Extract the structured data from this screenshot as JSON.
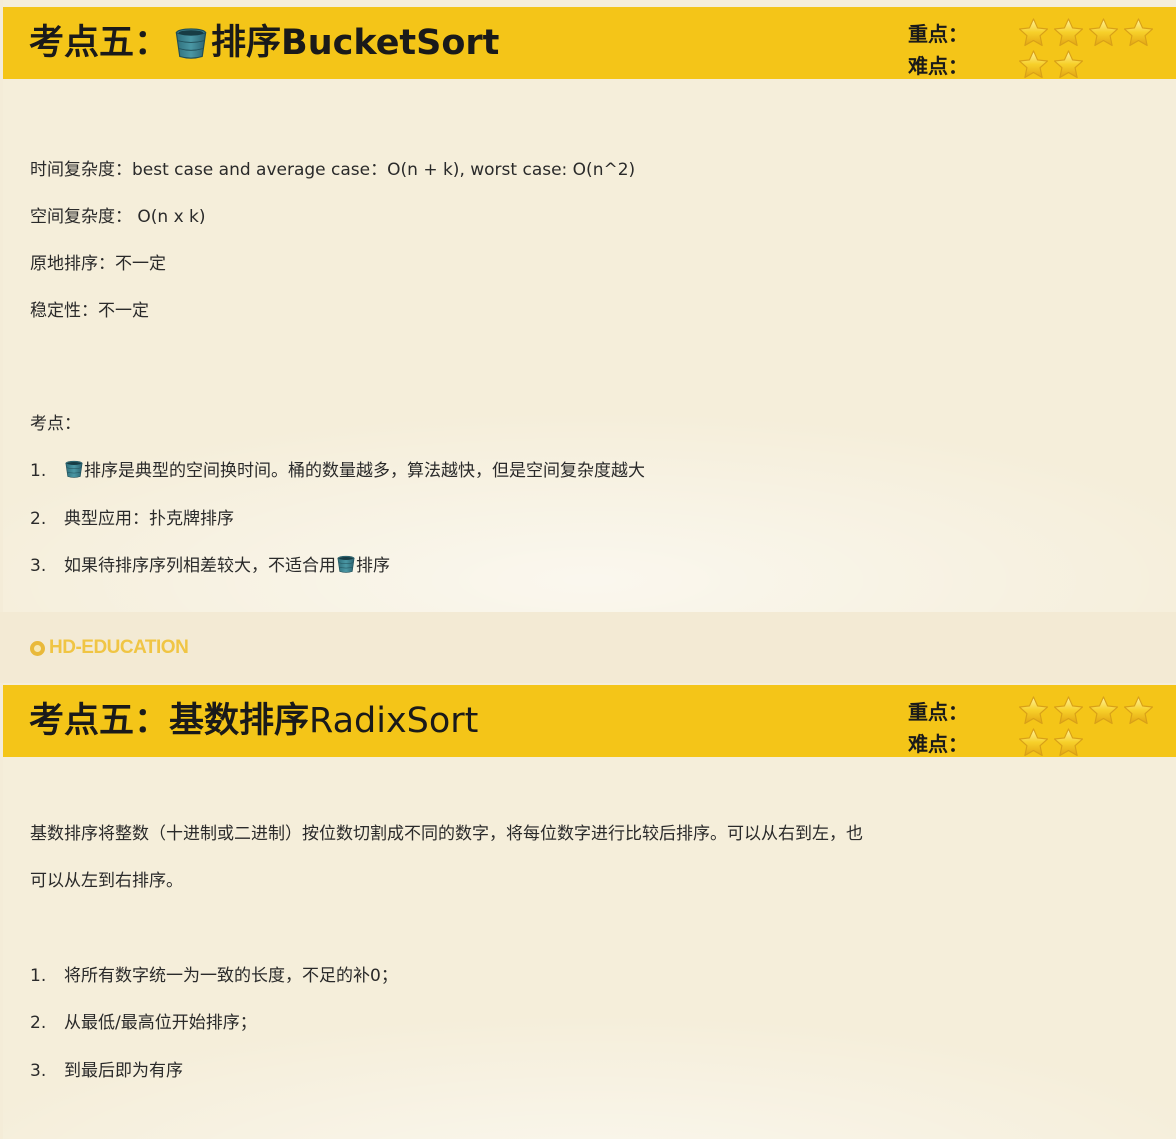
{
  "slide1": {
    "title_cn": "考点五：",
    "title_icon": "bucket-icon",
    "title_rest": "排序BucketSort",
    "ratings": {
      "importance_label": "重点：",
      "importance_stars": 4,
      "difficulty_label": "难点：",
      "difficulty_stars": 2
    },
    "props": [
      "时间复杂度：best case and average case：O(n + k), worst case: O(n^2)",
      "空间复杂度： O(n x k)",
      "原地排序：不一定",
      "稳定性：不一定"
    ],
    "points_heading": "考点：",
    "points": [
      {
        "num": "1.",
        "text": "排序是典型的空间换时间。桶的数量越多，算法越快，但是空间复杂度越大"
      },
      {
        "num": "2.",
        "text": "典型应用：扑克牌排序"
      },
      {
        "num": "3.",
        "text_before": "如果待排序序列相差较大，不适合用",
        "text_after": "排序"
      }
    ]
  },
  "logo": "HD-EDUCATION",
  "slide2": {
    "title_cn": "考点五：基数排序 ",
    "title_en": "RadixSort",
    "ratings": {
      "importance_label": "重点：",
      "importance_stars": 4,
      "difficulty_label": "难点：",
      "difficulty_stars": 2
    },
    "desc_line1": "基数排序将整数（十进制或二进制）按位数切割成不同的数字，将每位数字进行比较后排序。可以从右到左，也",
    "desc_line2": "可以从左到右排序。",
    "steps": [
      {
        "num": "1.",
        "text": "将所有数字统一为一致的长度，不足的补0；"
      },
      {
        "num": "2.",
        "text": "从最低/最高位开始排序；"
      },
      {
        "num": "3.",
        "text": "到最后即为有序"
      }
    ]
  },
  "colors": {
    "banner": "#f4c518",
    "background": "#f5eeda",
    "star": "#f6c81e",
    "logo": "#f0c544"
  }
}
